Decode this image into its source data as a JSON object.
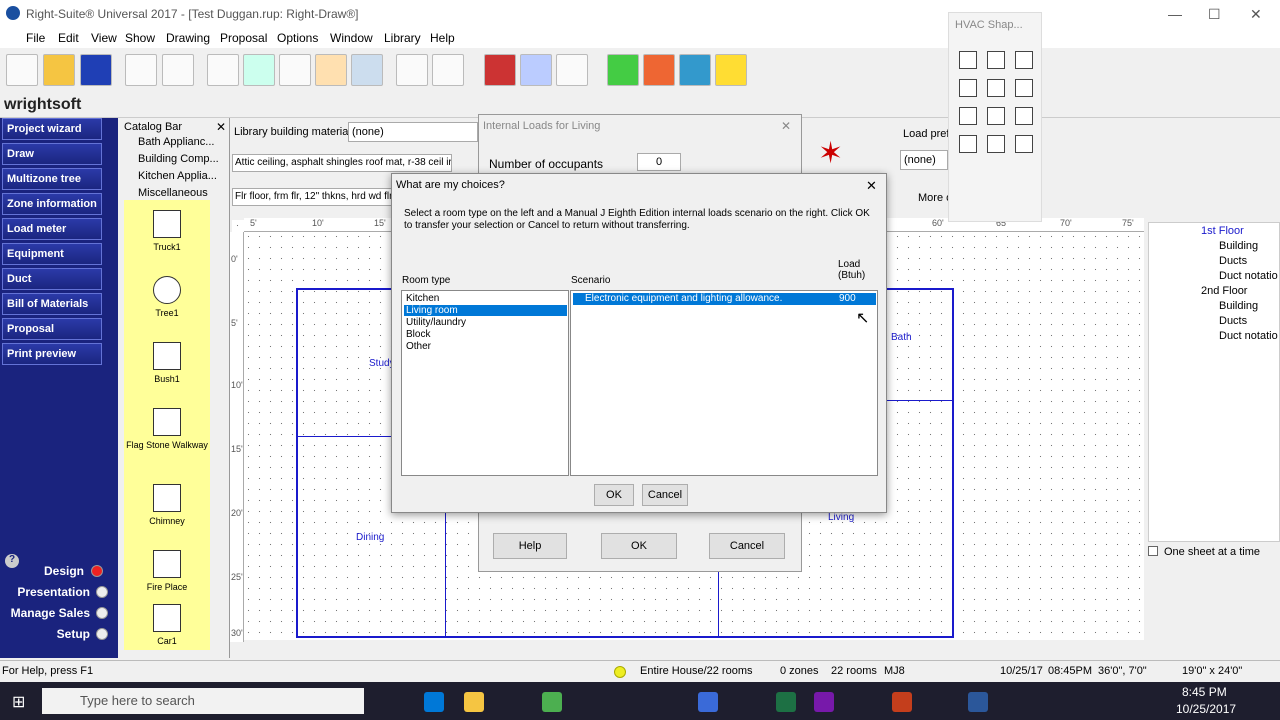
{
  "app": {
    "title": "Right-Suite® Universal 2017 - [Test Duggan.rup: Right-Draw®]",
    "logo": "wrightsoft"
  },
  "menu": [
    "File",
    "Edit",
    "View",
    "Show",
    "Drawing",
    "Proposal",
    "Options",
    "Window",
    "Library",
    "Help"
  ],
  "leftnav": [
    "Project wizard",
    "Draw",
    "Multizone tree",
    "Zone information",
    "Load meter",
    "Equipment",
    "Duct",
    "Bill of Materials",
    "Proposal",
    "Print preview"
  ],
  "modes": [
    "Design",
    "Presentation",
    "Manage Sales",
    "Setup"
  ],
  "catalog": {
    "title": "Catalog Bar",
    "items": [
      "Bath Applianc...",
      "Building Comp...",
      "Kitchen Applia...",
      "Miscellaneous"
    ],
    "symbols": [
      "Truck1",
      "Tree1",
      "Bush1",
      "Flag Stone Walkway",
      "Chimney",
      "Fire Place",
      "Car1"
    ]
  },
  "library": {
    "label": "Library building materials",
    "value": "(none)",
    "roof": "Attic ceiling, asphalt shingles roof mat, r-38 ceil ir",
    "floor": "Flr floor, frm flr, 12\" thkns, hrd wd flr"
  },
  "ruler": {
    "top": [
      "5'",
      "10'",
      "15'",
      "60'",
      "65'",
      "70'",
      "75'"
    ],
    "left": [
      "0'",
      "5'",
      "10'",
      "15'",
      "20'",
      "25'",
      "30'"
    ]
  },
  "rooms": [
    "Study",
    "Bath",
    "Dining",
    "Living"
  ],
  "right": {
    "load_pref": "Load pref",
    "none": "(none)",
    "more": "More o"
  },
  "tree": {
    "floor1": "1st Floor",
    "floor2": "2nd Floor",
    "items": [
      "Building",
      "Ducts",
      "Duct notatio"
    ],
    "one_sheet": "One sheet at a time"
  },
  "hvac": {
    "title": "HVAC Shap..."
  },
  "bg_dialog": {
    "title": "Internal Loads for Living",
    "occupants_label": "Number of occupants",
    "occupants": "0",
    "help": "Help",
    "ok": "OK",
    "cancel": "Cancel"
  },
  "dialog": {
    "title": "What are my choices?",
    "instructions": "Select a room type on the left and a Manual J Eighth Edition internal loads scenario on the right.  Click OK to transfer your selection or Cancel to return without transferring.",
    "col_room": "Room type",
    "col_scenario": "Scenario",
    "col_load": "Load (Btuh)",
    "room_types": [
      "Kitchen",
      "Living room",
      "Utility/laundry",
      "Block",
      "Other"
    ],
    "scenario": "Electronic equipment and lighting allowance.",
    "load": "900",
    "ok": "OK",
    "cancel": "Cancel"
  },
  "status": {
    "help": "For Help, press F1",
    "house": "Entire House/22 rooms",
    "zones": "0 zones",
    "rooms": "22 rooms",
    "mj": "MJ8",
    "date": "10/25/17",
    "time": "08:45PM",
    "coord": "36'0\", 7'0\"",
    "size": "19'0\" x 24'0\""
  },
  "taskbar": {
    "search": "Type here to search",
    "clock": "8:45 PM",
    "date": "10/25/2017"
  },
  "colors": {
    "nav": "#1a237e",
    "select": "#0078d7",
    "room": "#1a1acc",
    "yellow": "#ffff99"
  }
}
